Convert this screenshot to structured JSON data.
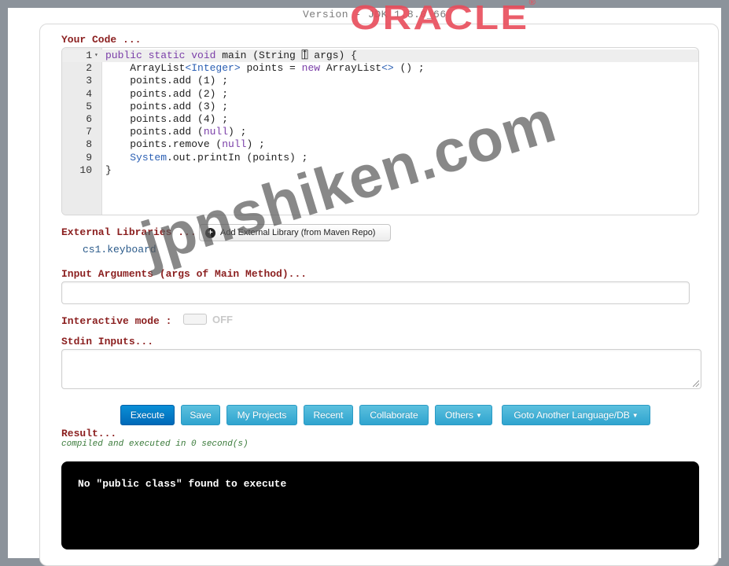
{
  "header": {
    "version_text": "Version - JDK 1.8.0_66",
    "logo_text": "ORACLE",
    "logo_reg": "®"
  },
  "code_section": {
    "label": "Your Code ...",
    "lines": [
      {
        "n": "1",
        "parts": [
          {
            "t": "public static void",
            "c": "kw"
          },
          {
            "t": " main (",
            "c": ""
          },
          {
            "t": "String",
            "c": ""
          },
          {
            "t": " ⍐ args) {",
            "c": ""
          }
        ]
      },
      {
        "n": "2",
        "parts": [
          {
            "t": "    ArrayList",
            "c": ""
          },
          {
            "t": "<Integer>",
            "c": "ty"
          },
          {
            "t": " points = ",
            "c": ""
          },
          {
            "t": "new",
            "c": "kw"
          },
          {
            "t": " ArrayList",
            "c": ""
          },
          {
            "t": "<>",
            "c": "ty"
          },
          {
            "t": " () ;",
            "c": ""
          }
        ]
      },
      {
        "n": "3",
        "parts": [
          {
            "t": "    points.add (1) ;",
            "c": ""
          }
        ]
      },
      {
        "n": "4",
        "parts": [
          {
            "t": "    points.add (2) ;",
            "c": ""
          }
        ]
      },
      {
        "n": "5",
        "parts": [
          {
            "t": "    points.add (3) ;",
            "c": ""
          }
        ]
      },
      {
        "n": "6",
        "parts": [
          {
            "t": "    points.add (4) ;",
            "c": ""
          }
        ]
      },
      {
        "n": "7",
        "parts": [
          {
            "t": "    points.add (",
            "c": ""
          },
          {
            "t": "null",
            "c": "kw"
          },
          {
            "t": ") ;",
            "c": ""
          }
        ]
      },
      {
        "n": "8",
        "parts": [
          {
            "t": "    points.remove (",
            "c": ""
          },
          {
            "t": "null",
            "c": "kw"
          },
          {
            "t": ") ;",
            "c": ""
          }
        ]
      },
      {
        "n": "9",
        "parts": [
          {
            "t": "    ",
            "c": ""
          },
          {
            "t": "System",
            "c": "sys"
          },
          {
            "t": ".out.printIn (points) ;",
            "c": ""
          }
        ]
      },
      {
        "n": "10",
        "parts": [
          {
            "t": "}",
            "c": ""
          }
        ]
      }
    ]
  },
  "external_libraries": {
    "label": "External Libraries ...",
    "add_button": "Add External Library (from Maven Repo)",
    "items": [
      "cs1.keyboard"
    ]
  },
  "input_arguments": {
    "label": "Input Arguments (args of Main Method)...",
    "value": ""
  },
  "interactive_mode": {
    "label": "Interactive mode :",
    "state": "OFF"
  },
  "stdin": {
    "label": "Stdin Inputs...",
    "value": ""
  },
  "toolbar": {
    "execute": "Execute",
    "save": "Save",
    "my_projects": "My Projects",
    "recent": "Recent",
    "collaborate": "Collaborate",
    "others": "Others",
    "goto_language": "Goto Another Language/DB"
  },
  "result": {
    "label": "Result...",
    "status": "compiled and executed in 0 second(s)",
    "output": "No \"public class\" found to execute"
  },
  "watermark": "jpnshiken.com",
  "colors": {
    "label_red": "#8b1f1f",
    "button_blue": "#2fa4cf",
    "execute_blue": "#0069b8",
    "oracle_red": "#e84c5a"
  }
}
